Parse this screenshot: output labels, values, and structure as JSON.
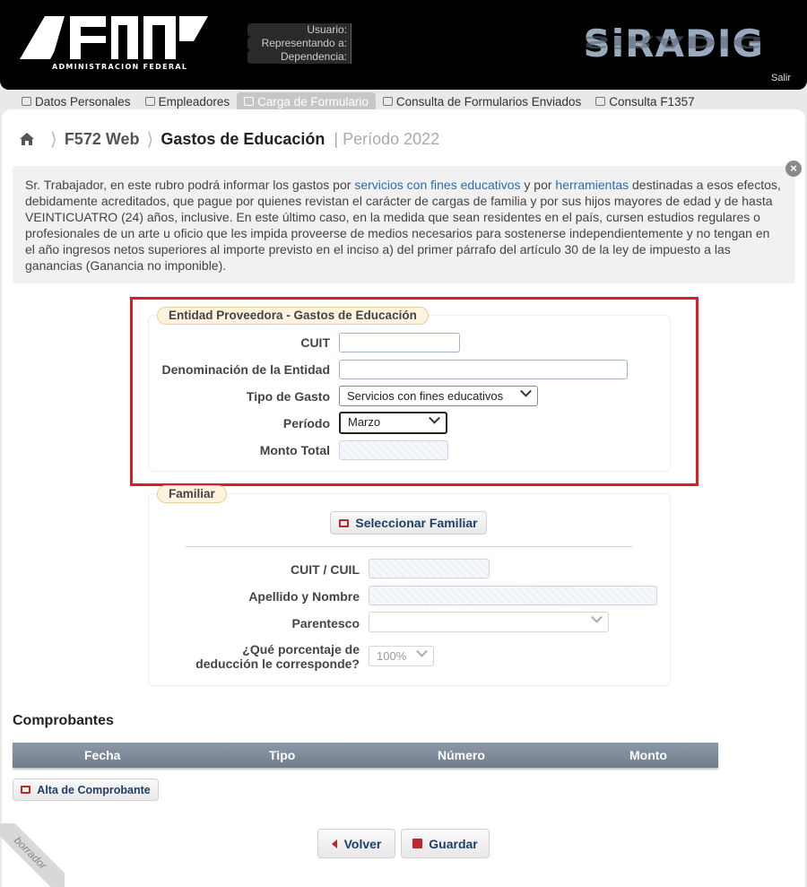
{
  "header": {
    "logo_caption": "ADMINISTRACION FEDERAL",
    "user_labels": [
      "Usuario:",
      "Representando a:",
      "Dependencia:"
    ],
    "app_name": "SiRADIG",
    "logout": "Salir"
  },
  "nav": {
    "items": [
      {
        "label": "Datos Personales",
        "icon": "person-icon"
      },
      {
        "label": "Empleadores",
        "icon": "building-icon"
      },
      {
        "label": "Carga de Formulario",
        "icon": "document-icon"
      },
      {
        "label": "Consulta de Formularios Enviados",
        "icon": "mail-icon"
      },
      {
        "label": "Consulta F1357",
        "icon": "mail-icon"
      }
    ],
    "active_index": 2
  },
  "breadcrumb": {
    "root": "F572 Web",
    "title": "Gastos de Educación",
    "periodo": "| Período 2022"
  },
  "info": {
    "text_1": "Sr. Trabajador, en este rubro podrá informar los gastos por ",
    "link_1": "servicios con fines educativos",
    "text_2": " y por ",
    "link_2": "herramientas",
    "text_3": " destinadas a esos efectos, debidamente acreditados, que pague por quienes revistan el carácter de cargas de familia y por sus hijos mayores de edad y de hasta VEINTICUATRO (24) años, inclusive. En este último caso, en la medida que sean residentes en el país, cursen estudios regulares o profesionales de un arte u oficio que les impida proveerse de medios necesarios para sostenerse independientemente y no tengan en el año ingresos netos superiores al importe previsto en el inciso a) del primer párrafo del artículo 30 de la ley de impuesto a las ganancias (Ganancia no imponible)."
  },
  "entidad": {
    "legend": "Entidad Proveedora - Gastos de Educación",
    "cuit_label": "CUIT",
    "cuit_value": "",
    "denominacion_label": "Denominación de la Entidad",
    "denominacion_value": "",
    "tipo_label": "Tipo de Gasto",
    "tipo_value": "Servicios con fines educativos",
    "periodo_label": "Período",
    "periodo_value": "Marzo",
    "monto_label": "Monto Total",
    "monto_value": ""
  },
  "familiar": {
    "legend": "Familiar",
    "select_button": "Seleccionar Familiar",
    "cuit_label": "CUIT / CUIL",
    "apellido_label": "Apellido y Nombre",
    "parentesco_label": "Parentesco",
    "parentesco_value": "",
    "porcentaje_label_1": "¿Qué porcentaje de",
    "porcentaje_label_2": "deducción le corresponde?",
    "porcentaje_value": "100%"
  },
  "comprobantes": {
    "title": "Comprobantes",
    "columns": [
      "Fecha",
      "Tipo",
      "Número",
      "Monto"
    ],
    "rows": [],
    "add_button": "Alta de Comprobante"
  },
  "actions": {
    "back": "Volver",
    "save": "Guardar"
  },
  "watermark": "borrador",
  "colors": {
    "header_bg": "#000000",
    "highlight_frame": "#e21b22",
    "link": "#2a6db3",
    "table_header": "#7d8898",
    "accent_icon": "#c0272d"
  }
}
